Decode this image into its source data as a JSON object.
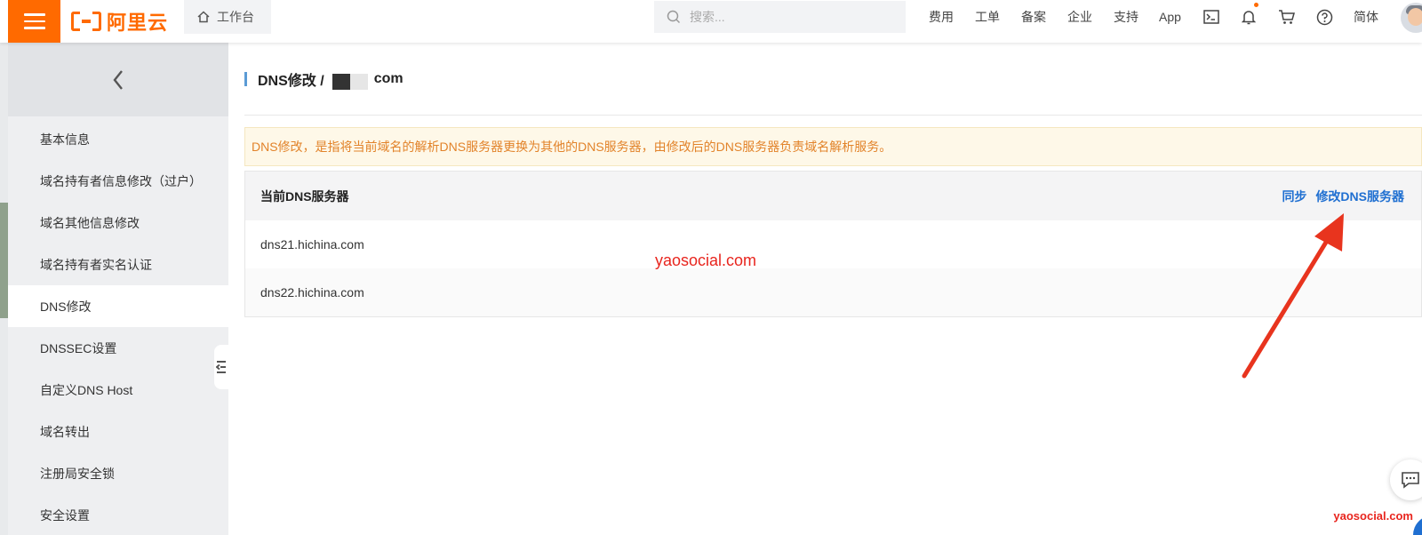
{
  "header": {
    "logo_text": "阿里云",
    "workbench_label": "工作台",
    "search_placeholder": "搜索...",
    "nav": [
      "费用",
      "工单",
      "备案",
      "企业",
      "支持",
      "App"
    ],
    "language": "简体",
    "accent_color": "#ff6a00",
    "icons": [
      "menu-icon",
      "home-icon",
      "search-icon",
      "terminal-icon",
      "bell-icon",
      "cart-icon",
      "help-icon",
      "avatar"
    ]
  },
  "sidebar": {
    "back_icon": "chevron-left-icon",
    "items": [
      {
        "label": "基本信息"
      },
      {
        "label": "域名持有者信息修改（过户）"
      },
      {
        "label": "域名其他信息修改"
      },
      {
        "label": "域名持有者实名认证"
      },
      {
        "label": "DNS修改"
      },
      {
        "label": "DNSSEC设置"
      },
      {
        "label": "自定义DNS Host"
      },
      {
        "label": "域名转出"
      },
      {
        "label": "注册局安全锁"
      },
      {
        "label": "安全设置"
      }
    ],
    "active": "DNS修改"
  },
  "page": {
    "title_prefix": "DNS修改 / ",
    "title_suffix": "com",
    "notice": "DNS修改，是指将当前域名的解析DNS服务器更换为其他的DNS服务器，由修改后的DNS服务器负责域名解析服务。",
    "table_header": "当前DNS服务器",
    "sync_label": "同步",
    "modify_label": "修改DNS服务器",
    "servers": [
      "dns21.hichina.com",
      "dns22.hichina.com"
    ],
    "link_color": "#1f6fd1",
    "notice_color": "#e2832a"
  },
  "watermark": "yaosocial.com",
  "watermark_corner": "yaosocial.com"
}
